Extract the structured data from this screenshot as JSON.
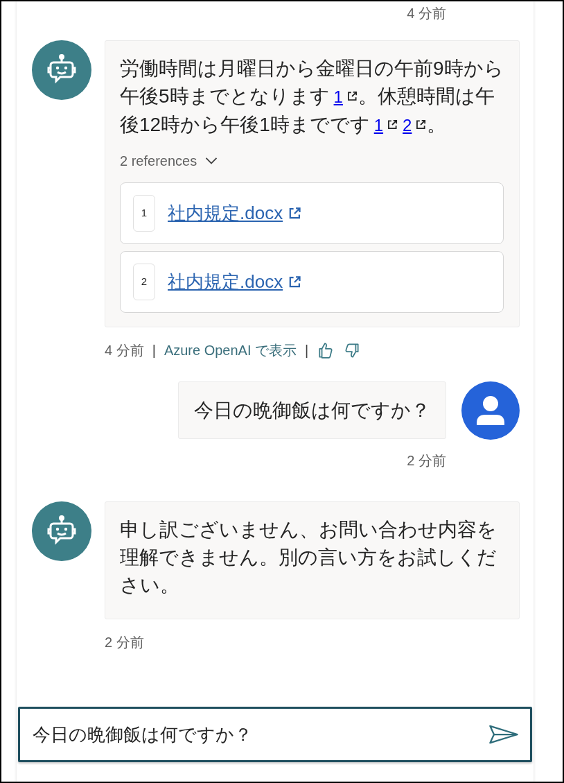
{
  "top_timestamp": "4 分前",
  "messages": [
    {
      "kind": "bot",
      "segments": [
        {
          "kind": "text",
          "text": "労働時間は月曜日から金曜日の午前9時から午後5時までとなります"
        },
        {
          "kind": "citation",
          "text": "1"
        },
        {
          "kind": "text",
          "text": "。休憩時間は午後12時から午後1時までです"
        },
        {
          "kind": "citation",
          "text": "1"
        },
        {
          "kind": "citation",
          "text": "2"
        },
        {
          "kind": "text",
          "text": "。"
        }
      ],
      "references": {
        "label": "2 references",
        "expanded": true,
        "items": [
          {
            "number": "1",
            "title": "社内規定.docx"
          },
          {
            "number": "2",
            "title": "社内規定.docx"
          }
        ]
      },
      "footer": [
        {
          "kind": "time",
          "text": "4 分前"
        },
        {
          "kind": "separator",
          "text": "|"
        },
        {
          "kind": "link",
          "text": "Azure OpenAI で表示"
        },
        {
          "kind": "separator",
          "text": "|"
        },
        {
          "kind": "like"
        },
        {
          "kind": "dislike"
        }
      ]
    },
    {
      "kind": "user",
      "segments": [
        {
          "kind": "text",
          "text": "今日の晩御飯は何ですか？"
        }
      ],
      "footer": [
        {
          "kind": "time",
          "text": "2 分前"
        }
      ]
    },
    {
      "kind": "bot",
      "segments": [
        {
          "kind": "text",
          "text": "申し訳ございません、お問い合わせ内容を理解できません。別の言い方をお試しください。"
        }
      ],
      "footer": [
        {
          "kind": "time",
          "text": "2 分前"
        }
      ]
    }
  ],
  "composer": {
    "value": "今日の晩御飯は何ですか？"
  }
}
